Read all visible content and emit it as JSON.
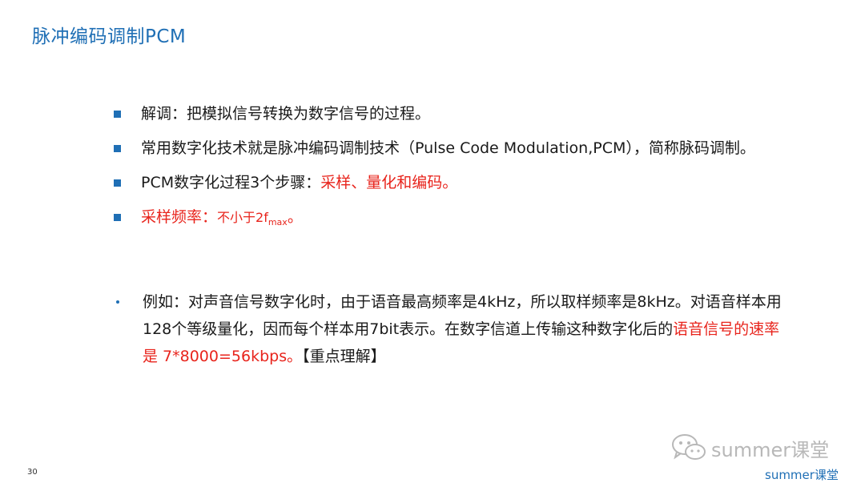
{
  "slide": {
    "title": "脉冲编码调制PCM",
    "page_number": "30",
    "bullets": [
      {
        "text": "解调：把模拟信号转换为数字信号的过程。"
      },
      {
        "text": "常用数字化技术就是脉冲编码调制技术（Pulse Code Modulation,PCM），简称脉码调制。"
      },
      {
        "prefix": "PCM数字化过程3个步骤：",
        "highlight": "采样、量化和编码。"
      },
      {
        "label": "采样频率：",
        "value_prefix": "不小于2f",
        "subscript": "max",
        "suffix": "。"
      }
    ],
    "example": {
      "text_before": "例如：对声音信号数字化时，由于语音最高频率是4kHz，所以取样频率是8kHz。对语音样本用128个等级量化，因而每个样本用7bit表示。在数字信道上传输这种数字化后的",
      "highlight": "语音信号的速率是 7*8000=56kbps。",
      "text_after": "【重点理解】"
    },
    "watermark": {
      "text": "summer课堂",
      "icon": "wechat-icon"
    },
    "brand": "summer课堂",
    "colors": {
      "accent": "#1f6fb5",
      "highlight": "#e8241c",
      "watermark": "#b8b8b8"
    }
  }
}
